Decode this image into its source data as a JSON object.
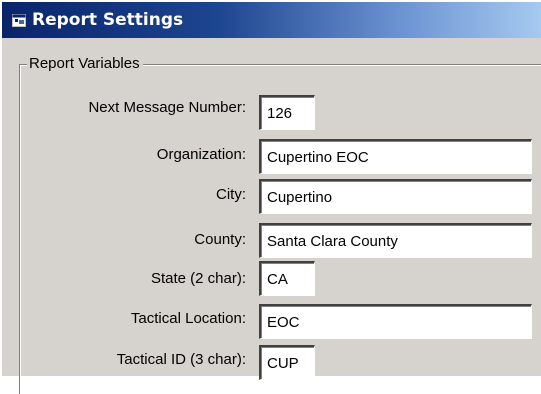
{
  "window": {
    "title": "Report Settings",
    "icon": "report-settings-icon"
  },
  "group": {
    "legend": "Report Variables"
  },
  "fields": [
    {
      "label": "Next Message Number:",
      "value": "126"
    },
    {
      "label": "Organization:",
      "value": "Cupertino EOC"
    },
    {
      "label": "City:",
      "value": "Cupertino"
    },
    {
      "label": "County:",
      "value": "Santa Clara County"
    },
    {
      "label": "State (2 char):",
      "value": "CA"
    },
    {
      "label": "Tactical Location:",
      "value": "EOC"
    },
    {
      "label": "Tactical ID (3 char):",
      "value": "CUP"
    }
  ],
  "colors": {
    "titlebar_start": "#0a246a",
    "titlebar_end": "#a6caf0",
    "window_face": "#d6d3ce"
  }
}
